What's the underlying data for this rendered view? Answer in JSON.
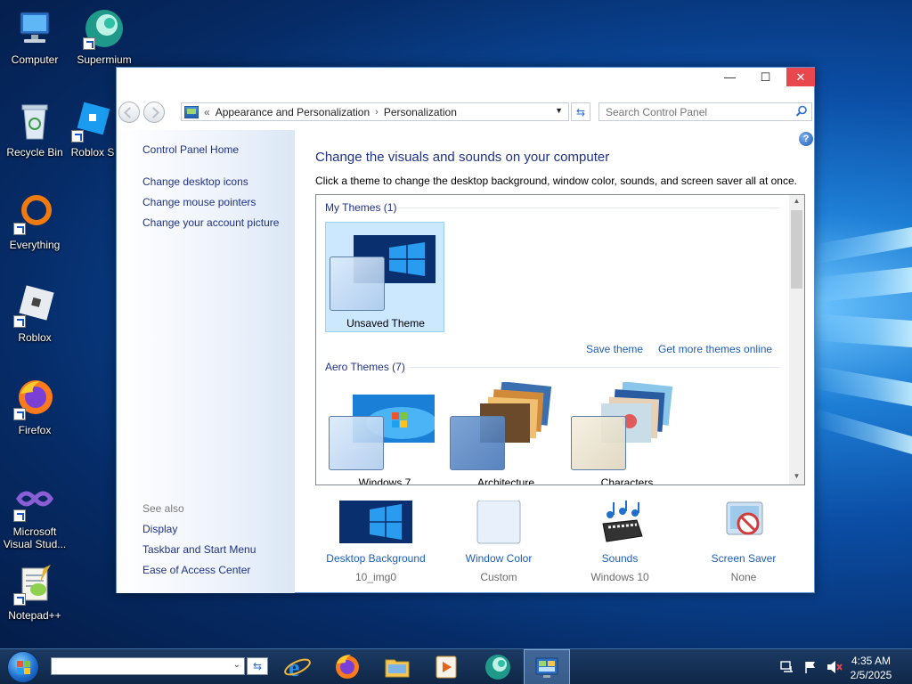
{
  "desktop": {
    "icons": [
      {
        "label": "Computer"
      },
      {
        "label": "Supermium"
      },
      {
        "label": "Recycle Bin"
      },
      {
        "label": "Roblox S"
      },
      {
        "label": "Everything"
      },
      {
        "label": "Roblox"
      },
      {
        "label": "Firefox"
      },
      {
        "label": "Microsoft Visual Stud..."
      },
      {
        "label": "Notepad++"
      }
    ]
  },
  "window": {
    "controls": {
      "minimize": "—",
      "maximize": "☐",
      "close": "✕"
    },
    "breadcrumb": {
      "prefix": "«",
      "items": [
        "Appearance and Personalization",
        "Personalization"
      ],
      "separator": "›"
    },
    "search": {
      "placeholder": "Search Control Panel"
    },
    "sidebar": {
      "home": "Control Panel Home",
      "links": [
        "Change desktop icons",
        "Change mouse pointers",
        "Change your account picture"
      ],
      "see_also_label": "See also",
      "see_also": [
        "Display",
        "Taskbar and Start Menu",
        "Ease of Access Center"
      ]
    },
    "main": {
      "title": "Change the visuals and sounds on your computer",
      "subtitle": "Click a theme to change the desktop background, window color, sounds, and screen saver all at once.",
      "my_themes_header": "My Themes (1)",
      "my_themes": [
        {
          "name": "Unsaved Theme"
        }
      ],
      "save_theme": "Save theme",
      "get_more": "Get more themes online",
      "aero_header": "Aero Themes (7)",
      "aero_themes": [
        {
          "name": "Windows 7"
        },
        {
          "name": "Architecture"
        },
        {
          "name": "Characters"
        }
      ]
    },
    "bottom": [
      {
        "label": "Desktop Background",
        "value": "10_img0"
      },
      {
        "label": "Window Color",
        "value": "Custom"
      },
      {
        "label": "Sounds",
        "value": "Windows 10"
      },
      {
        "label": "Screen Saver",
        "value": "None"
      }
    ]
  },
  "taskbar": {
    "search_value": "",
    "apps": [
      "internet-explorer",
      "firefox",
      "file-explorer",
      "media-player",
      "supermium",
      "control-panel"
    ],
    "clock": {
      "time": "4:35 AM",
      "date": "2/5/2025"
    }
  },
  "colors": {
    "accent": "#1e3287",
    "link": "#1e5eb9",
    "selection": "#cce8ff",
    "close": "#e8474d"
  }
}
